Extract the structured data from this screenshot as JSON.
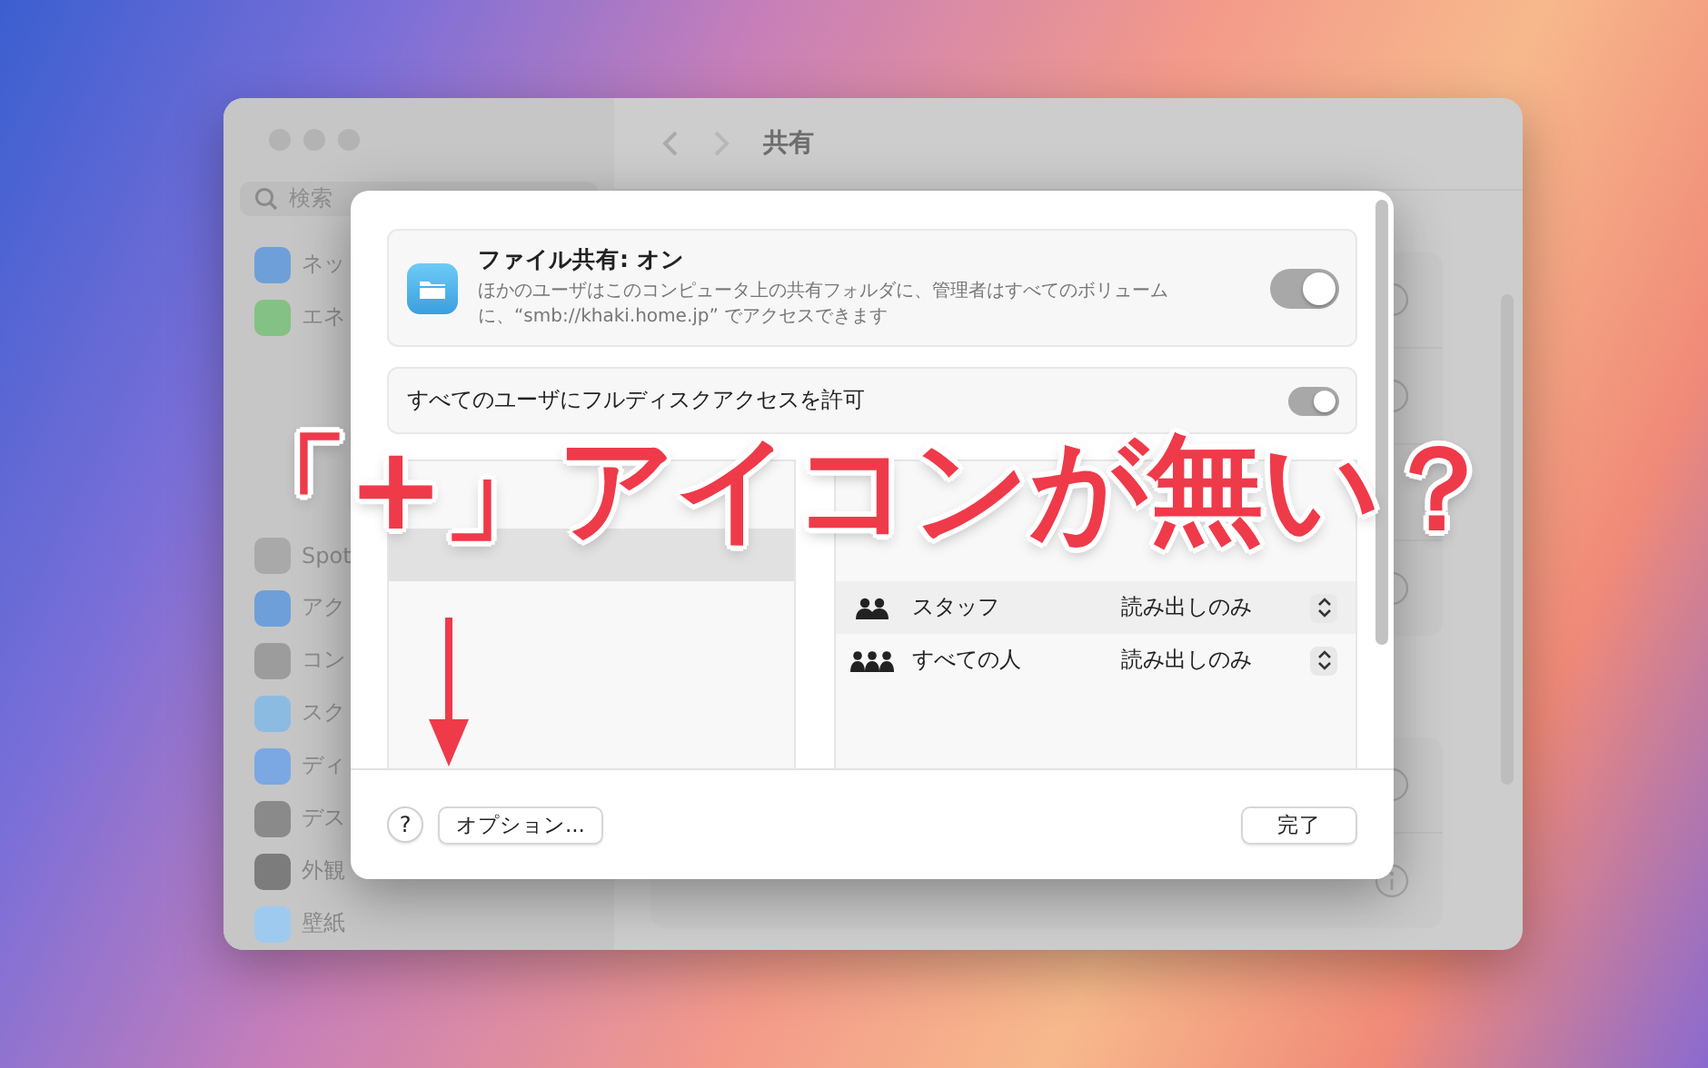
{
  "window": {
    "title": "共有",
    "search": {
      "placeholder": "検索"
    },
    "sidebar": {
      "groups": [
        [
          {
            "label": "ネッ",
            "color": "#6f9fd8"
          },
          {
            "label": "エネ",
            "color": "#84c184"
          }
        ],
        [
          {
            "label": "Spot",
            "color": "#a9a9a9"
          },
          {
            "label": "アク",
            "color": "#6f9fd8"
          },
          {
            "label": "コン",
            "color": "#9c9c9c"
          },
          {
            "label": "スク",
            "color": "#8cbbe2"
          },
          {
            "label": "ディ",
            "color": "#7ba8e2"
          },
          {
            "label": "デス",
            "color": "#8a8a8a"
          },
          {
            "label": "外観",
            "color": "#7c7c7c"
          },
          {
            "label": "壁紙",
            "color": "#9ecaf0"
          }
        ]
      ]
    },
    "services": [
      [
        {
          "kind": "info"
        },
        {
          "kind": "info"
        },
        {
          "kind": "hidden"
        },
        {
          "kind": "info"
        }
      ],
      [
        {
          "kind": "info"
        },
        {
          "kind": "info"
        }
      ]
    ]
  },
  "dialog": {
    "file_sharing": {
      "title": "ファイル共有: オン",
      "description": "ほかのユーザはこのコンピュータ上の共有フォルダに、管理者はすべてのボリュームに、“smb://khaki.home.jp” でアクセスできます",
      "on": true
    },
    "full_disk_access": {
      "label": "すべてのユーザにフルディスクアクセスを許可",
      "on": true
    },
    "users": [
      {
        "kind": "group",
        "name": "スタッフ",
        "permission": "読み出しのみ"
      },
      {
        "kind": "everyone",
        "name": "すべての人",
        "permission": "読み出しのみ"
      }
    ],
    "help_button": "?",
    "options_button": "オプション...",
    "done_button": "完了"
  },
  "caption": "「+」アイコンが無い？"
}
